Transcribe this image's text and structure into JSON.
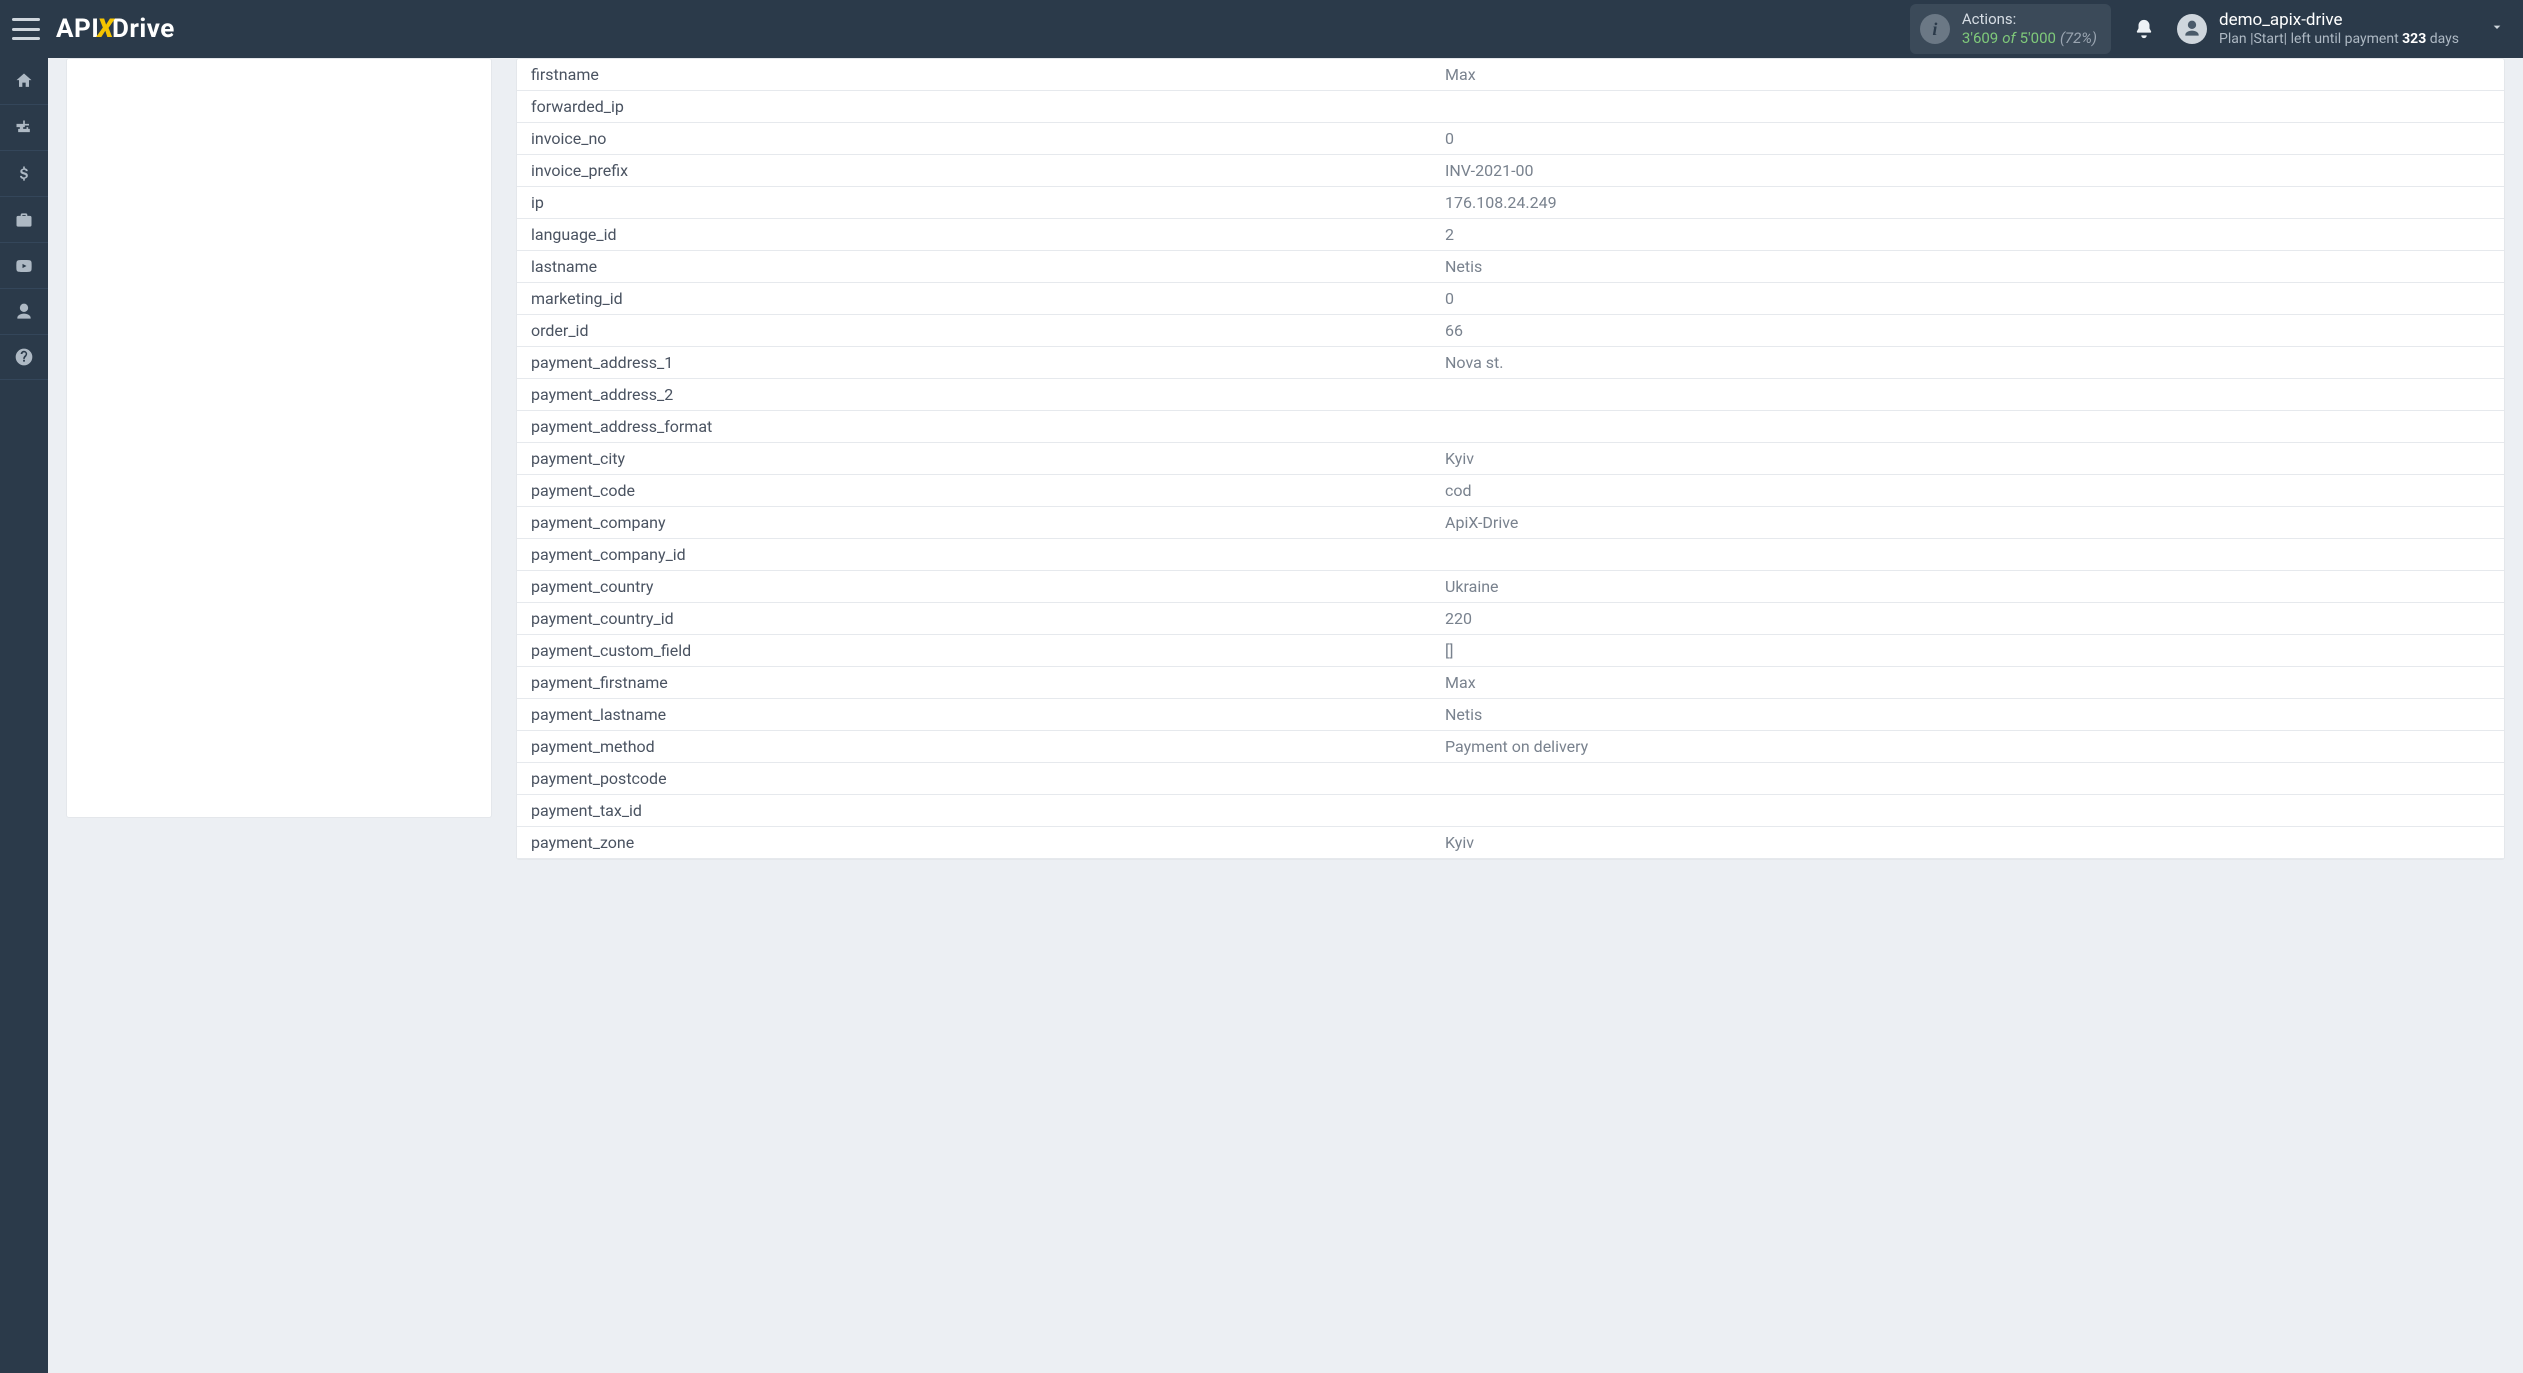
{
  "brand": {
    "part1": "API",
    "part2": "X",
    "part3": "Drive"
  },
  "actions": {
    "label": "Actions:",
    "used": "3'609",
    "of_word": "of",
    "total": "5'000",
    "percent": "(72%)"
  },
  "user": {
    "name": "demo_apix-drive",
    "plan_label": "Plan",
    "plan_name": "|Start|",
    "left_until_text": "left until payment",
    "days_number": "323",
    "days_word": "days"
  },
  "sidebar_icons": [
    "home",
    "tree",
    "dollar",
    "briefcase",
    "youtube",
    "user",
    "help"
  ],
  "rows": [
    {
      "key": "firstname",
      "val": "Max"
    },
    {
      "key": "forwarded_ip",
      "val": ""
    },
    {
      "key": "invoice_no",
      "val": "0"
    },
    {
      "key": "invoice_prefix",
      "val": "INV-2021-00"
    },
    {
      "key": "ip",
      "val": "176.108.24.249"
    },
    {
      "key": "language_id",
      "val": "2"
    },
    {
      "key": "lastname",
      "val": "Netis"
    },
    {
      "key": "marketing_id",
      "val": "0"
    },
    {
      "key": "order_id",
      "val": "66"
    },
    {
      "key": "payment_address_1",
      "val": "Nova st."
    },
    {
      "key": "payment_address_2",
      "val": ""
    },
    {
      "key": "payment_address_format",
      "val": ""
    },
    {
      "key": "payment_city",
      "val": "Kyiv"
    },
    {
      "key": "payment_code",
      "val": "cod"
    },
    {
      "key": "payment_company",
      "val": "ApiX-Drive"
    },
    {
      "key": "payment_company_id",
      "val": ""
    },
    {
      "key": "payment_country",
      "val": "Ukraine"
    },
    {
      "key": "payment_country_id",
      "val": "220"
    },
    {
      "key": "payment_custom_field",
      "val": "[]"
    },
    {
      "key": "payment_firstname",
      "val": "Max"
    },
    {
      "key": "payment_lastname",
      "val": "Netis"
    },
    {
      "key": "payment_method",
      "val": "Payment on delivery"
    },
    {
      "key": "payment_postcode",
      "val": ""
    },
    {
      "key": "payment_tax_id",
      "val": ""
    },
    {
      "key": "payment_zone",
      "val": "Kyiv"
    }
  ]
}
